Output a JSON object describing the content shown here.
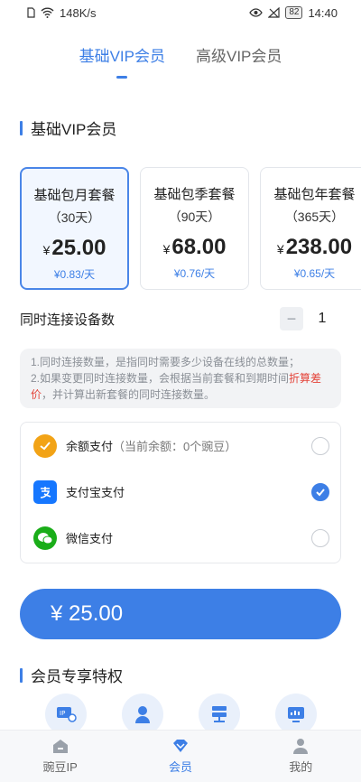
{
  "status_bar": {
    "speed": "148K/s",
    "battery": "82",
    "time": "14:40"
  },
  "top_tabs": [
    {
      "label": "基础VIP会员",
      "active": true
    },
    {
      "label": "高级VIP会员",
      "active": false
    }
  ],
  "section_basic": "基础VIP会员",
  "packages": [
    {
      "name": "基础包月套餐",
      "duration": "（30天）",
      "currency": "¥",
      "price": "25.00",
      "daily": "¥0.83/天",
      "selected": true
    },
    {
      "name": "基础包季套餐",
      "duration": "（90天）",
      "currency": "¥",
      "price": "68.00",
      "daily": "¥0.76/天",
      "selected": false
    },
    {
      "name": "基础包年套餐",
      "duration": "（365天）",
      "currency": "¥",
      "price": "238.00",
      "daily": "¥0.65/天",
      "selected": false
    }
  ],
  "devices": {
    "label": "同时连接设备数",
    "minus": "−",
    "value": "1"
  },
  "notice": {
    "line1": "1.同时连接数量，是指同时需要多少设备在线的总数量；",
    "line2_a": "2.如果变更同时连接数量，会根据当前套餐和到期时间",
    "line2_highlight": "折算差价",
    "line2_b": "，并计算出新套餐的同时连接数量。"
  },
  "payments": [
    {
      "label": "余额支付",
      "sub": "（当前余额：0个豌豆）",
      "icon": "balance-icon",
      "color": "#f2a316",
      "checked": false
    },
    {
      "label": "支付宝支付",
      "sub": "",
      "icon": "alipay-icon",
      "color": "#1677ff",
      "checked": true
    },
    {
      "label": "微信支付",
      "sub": "",
      "icon": "wechat-icon",
      "color": "#1aad19",
      "checked": false
    }
  ],
  "pay_button": {
    "label": "¥ 25.00"
  },
  "section_perks": "会员专享特权",
  "perk_icons": [
    "ip-switch-icon",
    "support-agent-icon",
    "server-icon",
    "speed-monitor-icon"
  ],
  "bottom_nav": [
    {
      "label": "豌豆IP",
      "icon": "home-icon",
      "active": false
    },
    {
      "label": "会员",
      "icon": "diamond-icon",
      "active": true
    },
    {
      "label": "我的",
      "icon": "user-icon",
      "active": false
    }
  ],
  "accent_color": "#3d7fe6"
}
